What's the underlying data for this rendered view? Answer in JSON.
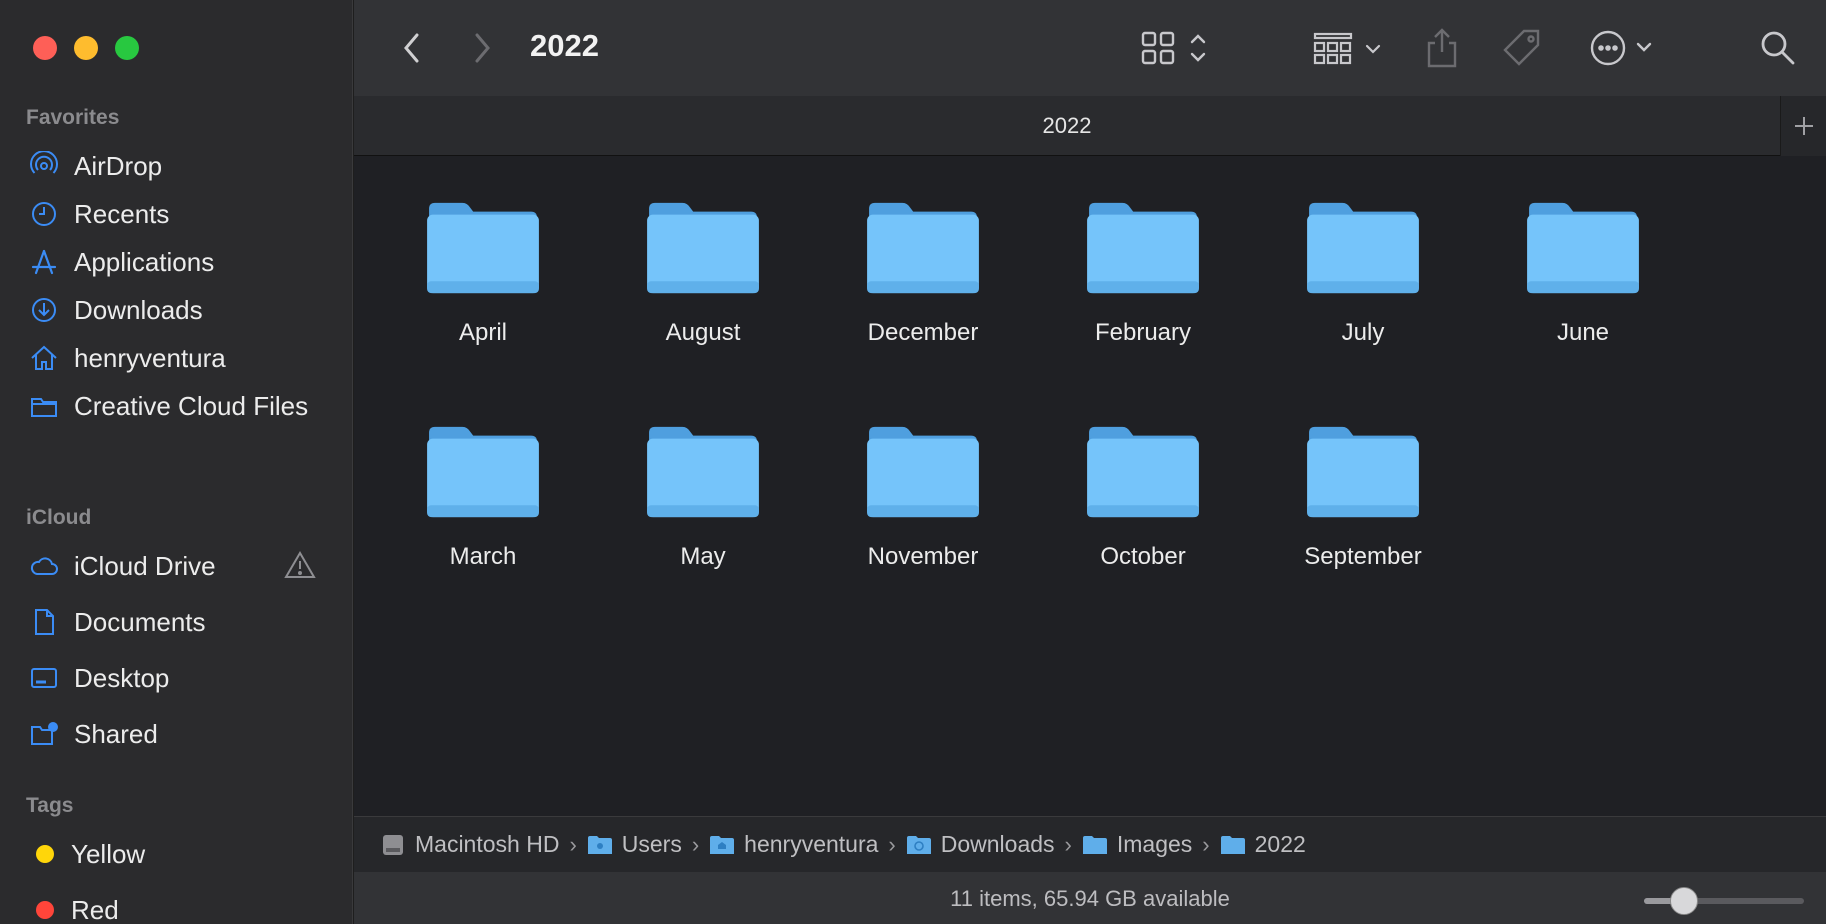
{
  "window": {
    "title": "2022",
    "tab_label": "2022"
  },
  "sidebar": {
    "favorites_title": "Favorites",
    "favorites": [
      {
        "label": "AirDrop",
        "icon": "airdrop-icon"
      },
      {
        "label": "Recents",
        "icon": "clock-icon"
      },
      {
        "label": "Applications",
        "icon": "applications-icon"
      },
      {
        "label": "Downloads",
        "icon": "download-icon"
      },
      {
        "label": "henryventura",
        "icon": "home-icon"
      },
      {
        "label": "Creative Cloud Files",
        "icon": "folder-icon"
      }
    ],
    "icloud_title": "iCloud",
    "icloud": [
      {
        "label": "iCloud Drive",
        "icon": "cloud-icon"
      },
      {
        "label": "Documents",
        "icon": "document-icon"
      },
      {
        "label": "Desktop",
        "icon": "desktop-icon"
      },
      {
        "label": "Shared",
        "icon": "shared-folder-icon"
      }
    ],
    "tags_title": "Tags",
    "tags": [
      {
        "label": "Yellow",
        "color": "#ffd60a"
      },
      {
        "label": "Red",
        "color": "#ff453a"
      }
    ]
  },
  "folders": [
    "April",
    "August",
    "December",
    "February",
    "July",
    "June",
    "March",
    "May",
    "November",
    "October",
    "September"
  ],
  "pathbar": [
    "Macintosh HD",
    "Users",
    "henryventura",
    "Downloads",
    "Images",
    "2022"
  ],
  "status": {
    "text": "11 items, 65.94 GB available",
    "zoom_level": 0.25
  },
  "colors": {
    "accent": "#3b8cf5",
    "folder": "#6cbcf5"
  }
}
